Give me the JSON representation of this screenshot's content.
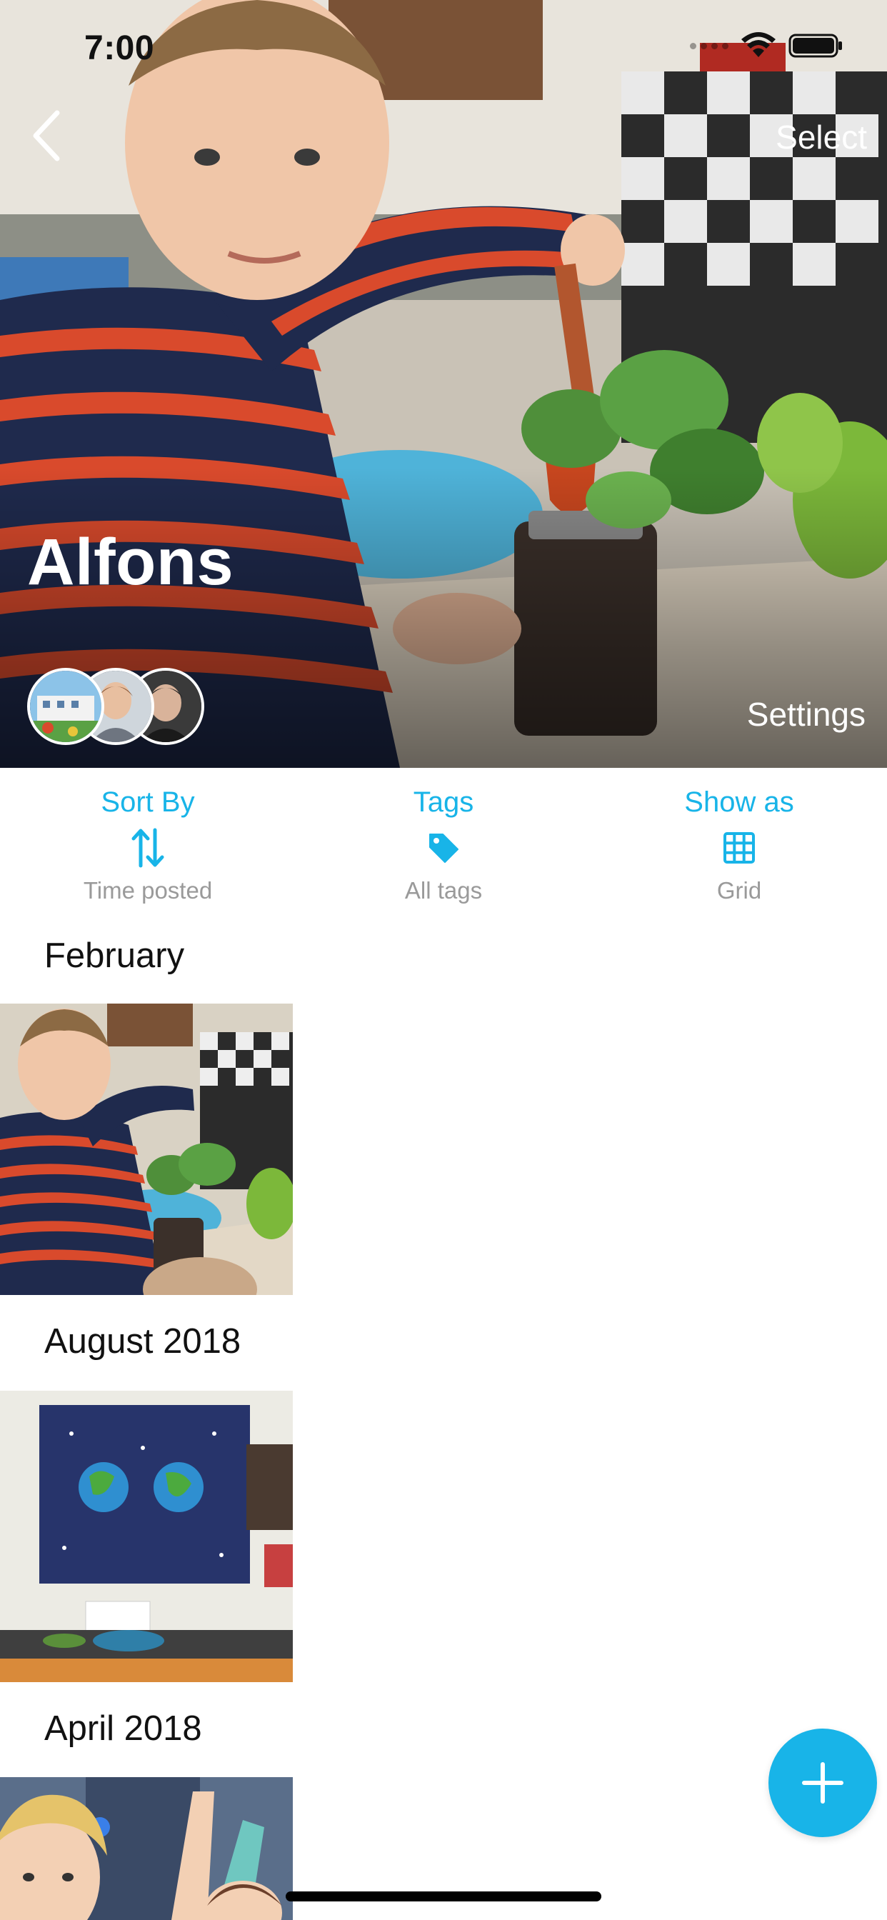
{
  "status_bar": {
    "time": "7:00"
  },
  "nav": {
    "back_icon": "chevron-left-icon",
    "select_label": "Select"
  },
  "profile": {
    "name": "Alfons",
    "settings_label": "Settings"
  },
  "toolbar": {
    "sort": {
      "label": "Sort By",
      "value": "Time posted",
      "icon": "sort-arrows-icon"
    },
    "tags": {
      "label": "Tags",
      "value": "All tags",
      "icon": "tag-icon"
    },
    "show_as": {
      "label": "Show as",
      "value": "Grid",
      "icon": "grid-icon"
    }
  },
  "sections": [
    {
      "title": "February"
    },
    {
      "title": "August 2018"
    },
    {
      "title": "April 2018"
    }
  ],
  "fab": {
    "icon": "plus-icon"
  },
  "colors": {
    "accent": "#18b4e8",
    "muted_text": "#9a9a9a",
    "text": "#111111"
  }
}
